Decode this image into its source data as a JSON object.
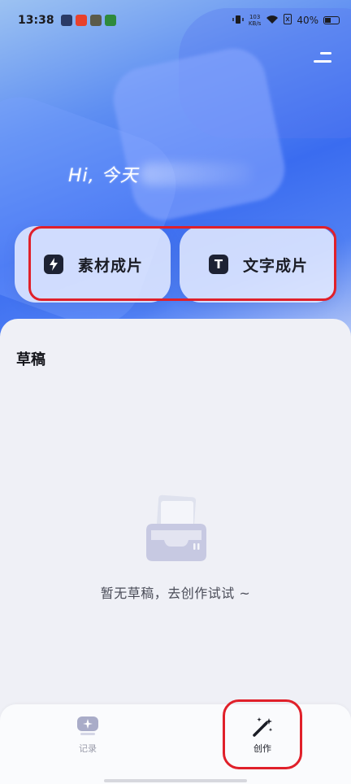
{
  "status_bar": {
    "time": "13:38",
    "network_speed_value": "103",
    "network_speed_unit": "KB/s",
    "battery": "40%"
  },
  "header": {
    "greeting": "Hi, 今天"
  },
  "actions": [
    {
      "label": "素材成片",
      "icon": "lightning-icon"
    },
    {
      "label": "文字成片",
      "icon": "text-t-icon",
      "icon_glyph": "T"
    }
  ],
  "drafts": {
    "title": "草稿",
    "empty_text": "暂无草稿，去创作试试 ~"
  },
  "tabbar": {
    "tabs": [
      {
        "label": "记录",
        "icon": "record-icon",
        "active": false
      },
      {
        "label": "创作",
        "icon": "magic-wand-icon",
        "active": true
      }
    ]
  },
  "colors": {
    "accent": "#3a6cf0",
    "highlight_box": "#e0202a"
  }
}
